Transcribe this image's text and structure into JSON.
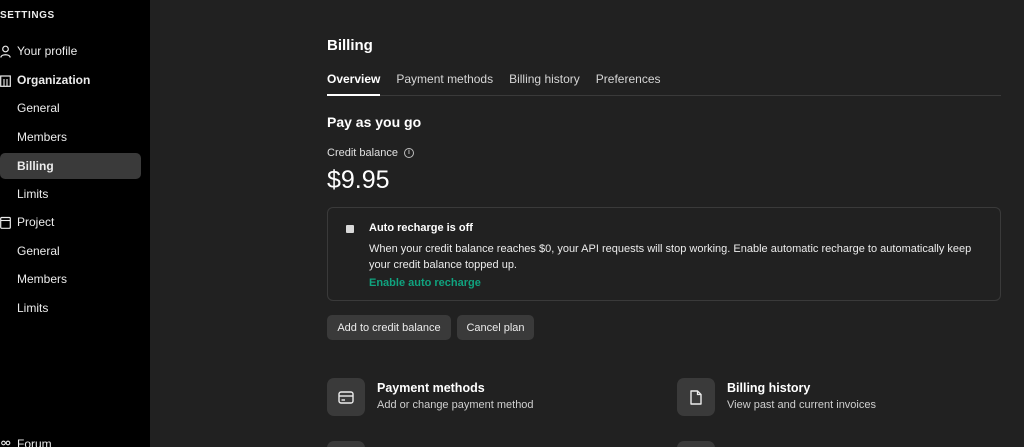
{
  "sidebar": {
    "heading": "SETTINGS",
    "items": [
      {
        "label": "Your profile",
        "icon": "person-icon"
      },
      {
        "label": "Organization",
        "icon": "building-icon"
      },
      {
        "label": "General"
      },
      {
        "label": "Members"
      },
      {
        "label": "Billing"
      },
      {
        "label": "Limits"
      },
      {
        "label": "Project",
        "icon": "project-icon"
      },
      {
        "label": "General"
      },
      {
        "label": "Members"
      },
      {
        "label": "Limits"
      },
      {
        "label": "Forum",
        "icon": "people-icon"
      }
    ]
  },
  "main": {
    "title": "Billing",
    "tabs": [
      {
        "label": "Overview"
      },
      {
        "label": "Payment methods"
      },
      {
        "label": "Billing history"
      },
      {
        "label": "Preferences"
      }
    ],
    "section_title": "Pay as you go",
    "credit_label": "Credit balance",
    "credit_value": "$9.95",
    "recharge": {
      "title": "Auto recharge is off",
      "description": "When your credit balance reaches $0, your API requests will stop working. Enable automatic recharge to automatically keep your credit balance topped up.",
      "link": "Enable auto recharge"
    },
    "buttons": {
      "add": "Add to credit balance",
      "cancel": "Cancel plan"
    },
    "cards": [
      {
        "title": "Payment methods",
        "subtitle": "Add or change payment method",
        "icon": "credit-card-icon"
      },
      {
        "title": "Billing history",
        "subtitle": "View past and current invoices",
        "icon": "document-icon"
      }
    ]
  },
  "colors": {
    "background": "#212121",
    "sidebar": "#000000",
    "accent_link": "#10a37f",
    "active_item": "#3a3a3a"
  }
}
